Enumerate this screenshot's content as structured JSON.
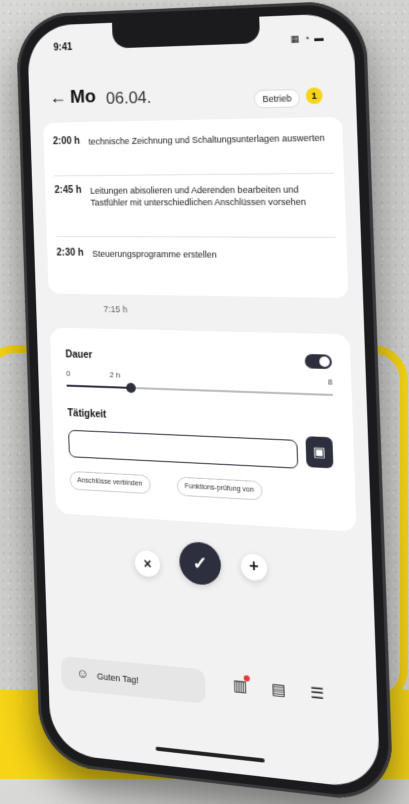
{
  "status": {
    "time": "9:41",
    "icons": "▦ ◔ ▬"
  },
  "header": {
    "back_icon": "←",
    "day": "Mo",
    "date": "06.04.",
    "tag": "Betrieb",
    "badge": "1"
  },
  "entries": [
    {
      "duration": "2:00 h",
      "description": "technische Zeichnung und Schaltungsunterlagen auswerten"
    },
    {
      "duration": "2:45 h",
      "description": "Leitungen abisolieren und Aderenden bearbeiten und Tastfühler mit unterschiedlichen Anschlüssen vorsehen"
    },
    {
      "duration": "2:30 h",
      "description": "Steuerungsprogramme erstellen"
    }
  ],
  "total": "7:15 h",
  "editor": {
    "duration_label": "Dauer",
    "slider_min": "0",
    "slider_mid": "2 h",
    "slider_max": "8",
    "slider_value_fraction": 0.25,
    "task_label": "Tätigkeit",
    "task_value": "",
    "camera_icon": "▣",
    "chips": [
      "Anschlüsse verbinden",
      "Funktions-prüfung von"
    ]
  },
  "actions": {
    "cancel": "×",
    "confirm": "✓",
    "add": "+"
  },
  "bottom": {
    "greet_icon": "☺",
    "greeting": "Guten Tag!",
    "report_icon": "▥",
    "doc_icon": "▤",
    "menu_icon": "☰"
  },
  "colors": {
    "accent": "#f7d516",
    "primary": "#2e2f3e",
    "alert": "#e53935"
  }
}
